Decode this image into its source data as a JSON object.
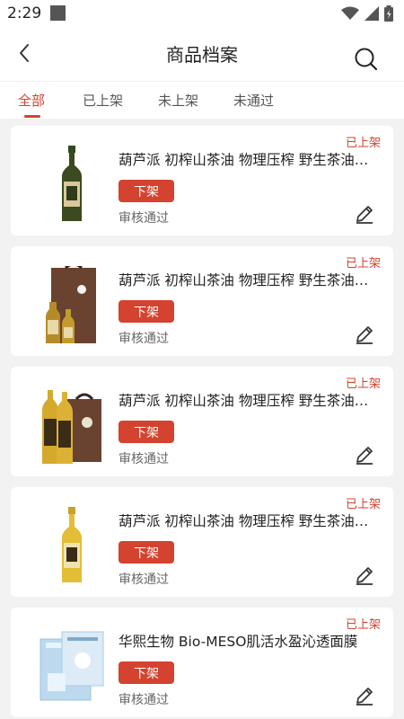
{
  "status_bar": {
    "time": "2:29"
  },
  "header": {
    "title": "商品档案"
  },
  "tabs": [
    {
      "label": "全部",
      "active": true
    },
    {
      "label": "已上架",
      "active": false
    },
    {
      "label": "未上架",
      "active": false
    },
    {
      "label": "未通过",
      "active": false
    }
  ],
  "products": [
    {
      "name": "葫芦派 初榨山茶油 物理压榨 野生茶油 食用油",
      "status": "已上架",
      "action_label": "下架",
      "review": "审核通过",
      "image": "single-dark-oil-bottle"
    },
    {
      "name": "葫芦派 初榨山茶油 物理压榨 野生茶油 食用油",
      "status": "已上架",
      "action_label": "下架",
      "review": "审核通过",
      "image": "gift-bag-with-two-bottles"
    },
    {
      "name": "葫芦派 初榨山茶油 物理压榨 野生茶油 食用油",
      "status": "已上架",
      "action_label": "下架",
      "review": "审核通过",
      "image": "two-bottles-with-gift-bag"
    },
    {
      "name": "葫芦派 初榨山茶油 物理压榨 野生茶油 食用油",
      "status": "已上架",
      "action_label": "下架",
      "review": "审核通过",
      "image": "single-golden-oil-bottle"
    },
    {
      "name": "华熙生物 Bio-MESO肌活水盈沁透面膜",
      "status": "已上架",
      "action_label": "下架",
      "review": "审核通过",
      "image": "facial-mask-package"
    }
  ],
  "colors": {
    "accent": "#d3432f",
    "background": "#f2f2f2"
  }
}
